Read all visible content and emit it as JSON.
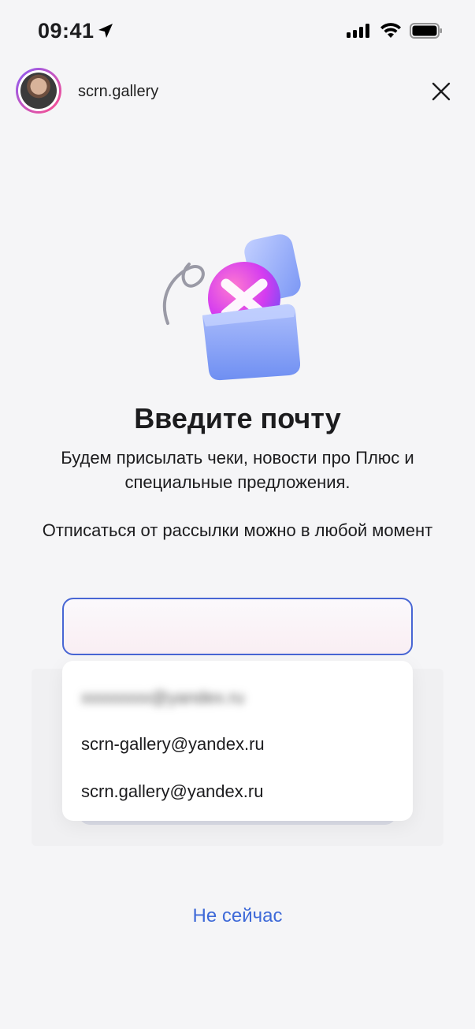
{
  "status_bar": {
    "time": "09:41",
    "icons": [
      "location-arrow-icon",
      "cellular-signal-icon",
      "wifi-icon",
      "battery-icon"
    ]
  },
  "header": {
    "username": "scrn.gallery",
    "close_icon": "close-icon"
  },
  "content": {
    "title": "Введите почту",
    "subtitle": "Будем присылать чеки, новости про Плюс и специальные предложения.",
    "note": "Отписаться от рассылки можно в любой момент"
  },
  "email_input": {
    "value": "",
    "placeholder": ""
  },
  "suggestions": [
    "scrn-gallery@yandex.ru",
    "scrn.gallery@yandex.ru"
  ],
  "actions": {
    "not_now_label": "Не сейчас"
  },
  "colors": {
    "accent": "#3f6ad8",
    "input_border": "#4866d4",
    "background": "#f5f5f7"
  }
}
